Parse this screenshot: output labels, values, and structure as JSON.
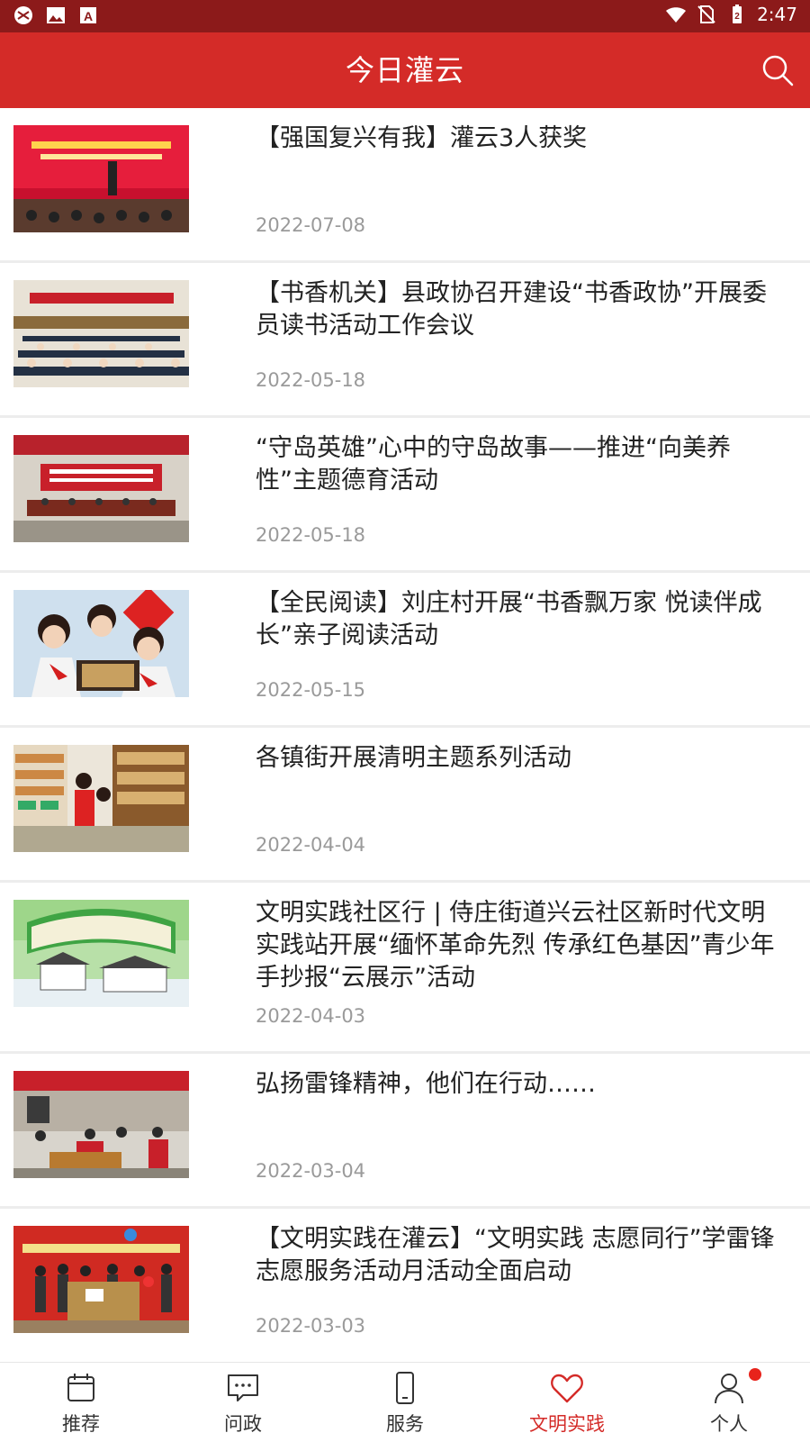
{
  "status_bar": {
    "time": "2:47"
  },
  "app_bar": {
    "title": "今日灌云"
  },
  "articles": [
    {
      "title": "【强国复兴有我】灌云3人获奖",
      "date": "2022-07-08"
    },
    {
      "title": "【书香机关】县政协召开建设“书香政协”开展委员读书活动工作会议",
      "date": "2022-05-18"
    },
    {
      "title": "“守岛英雄”心中的守岛故事——推进“向美养性”主题德育活动",
      "date": "2022-05-18"
    },
    {
      "title": "【全民阅读】刘庄村开展“书香飘万家 悦读伴成长”亲子阅读活动",
      "date": "2022-05-15"
    },
    {
      "title": "各镇街开展清明主题系列活动",
      "date": "2022-04-04"
    },
    {
      "title": "文明实践社区行 | 侍庄街道兴云社区新时代文明实践站开展“缅怀革命先烈 传承红色基因”青少年手抄报“云展示”活动",
      "date": "2022-04-03"
    },
    {
      "title": "弘扬雷锋精神，他们在行动……",
      "date": "2022-03-04"
    },
    {
      "title": "【文明实践在灌云】“文明实践 志愿同行”学雷锋志愿服务活动月活动全面启动",
      "date": "2022-03-03"
    }
  ],
  "tab_bar": [
    {
      "label": "推荐",
      "icon": "calendar-icon"
    },
    {
      "label": "问政",
      "icon": "chat-icon"
    },
    {
      "label": "服务",
      "icon": "phone-icon"
    },
    {
      "label": "文明实践",
      "icon": "heart-icon",
      "active": true
    },
    {
      "label": "个人",
      "icon": "person-icon"
    }
  ],
  "colors": {
    "status_bar": "#8c1a1a",
    "app_bar": "#d42b28",
    "active_tab": "#d42b28",
    "badge": "#e8231b"
  }
}
